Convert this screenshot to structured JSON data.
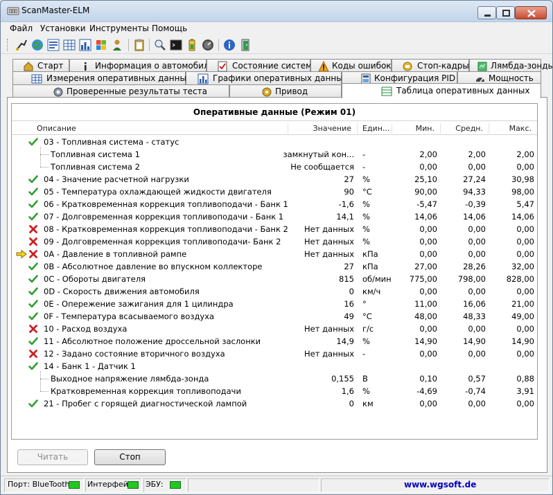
{
  "window": {
    "title": "ScanMaster-ELM"
  },
  "menu": [
    "Файл",
    "Установки",
    "Инструменты",
    "Помощь"
  ],
  "toolbar_icons": [
    "connect-icon",
    "globe-icon",
    "info-icon",
    "table-icon",
    "chart-icon",
    "windows-icon",
    "person-icon",
    "clipboard-icon",
    "search-icon",
    "terminal-icon",
    "battery-icon",
    "gauge-icon",
    "help-icon",
    "exit-icon"
  ],
  "tabs": {
    "row1": [
      {
        "label": "Старт",
        "icon": "home-icon"
      },
      {
        "label": "Информация о автомобиле",
        "icon": "info-icon"
      },
      {
        "label": "Состояние системы",
        "icon": "checklist-icon"
      },
      {
        "label": "Коды ошибок",
        "icon": "warning-icon"
      },
      {
        "label": "Стоп-кадры",
        "icon": "freeze-icon"
      },
      {
        "label": "Лямбда-зонды",
        "icon": "sensor-icon"
      }
    ],
    "row2": [
      {
        "label": "Измерения оперативных данных",
        "icon": "grid-icon"
      },
      {
        "label": "Графики оперативных данных",
        "icon": "chart-icon"
      },
      {
        "label": "Конфигурация PID",
        "icon": "config-icon"
      },
      {
        "label": "Мощность",
        "icon": "speedometer-icon"
      }
    ],
    "row3": [
      {
        "label": "Проверенные результаты теста",
        "icon": "gear-icon"
      },
      {
        "label": "Привод",
        "icon": "drive-icon"
      },
      {
        "label": "Таблица оперативных данных",
        "icon": "table-icon",
        "active": true
      }
    ]
  },
  "grid": {
    "title": "Оперативные данные (Режим 01)",
    "columns": {
      "desc": "Описание",
      "value": "Значение",
      "unit": "Един...",
      "min": "Мин.",
      "avg": "Средн.",
      "max": "Макс."
    },
    "rows": [
      {
        "mark": "check",
        "desc": "03 - Топливная система - статус",
        "value": "",
        "unit": "",
        "min": "",
        "avg": "",
        "max": ""
      },
      {
        "mark": "child",
        "desc": "Топливная система 1",
        "value": "замкнутый кон...",
        "unit": "-",
        "min": "2,00",
        "avg": "2,00",
        "max": "2,00"
      },
      {
        "mark": "child",
        "desc": "Топливная система 2",
        "value": "Не сообщается",
        "unit": "-",
        "min": "0,00",
        "avg": "0,00",
        "max": "0,00"
      },
      {
        "mark": "check",
        "desc": "04 - Значение расчетной нагрузки",
        "value": "27",
        "unit": "%",
        "min": "25,10",
        "avg": "27,24",
        "max": "30,98"
      },
      {
        "mark": "check",
        "desc": "05 - Температура охлаждающей жидкости двигателя",
        "value": "90",
        "unit": "°C",
        "min": "90,00",
        "avg": "94,33",
        "max": "98,00"
      },
      {
        "mark": "check",
        "desc": "06 - Кратковременная коррекция топливоподачи - Банк 1",
        "value": "-1,6",
        "unit": "%",
        "min": "-5,47",
        "avg": "-0,39",
        "max": "5,47"
      },
      {
        "mark": "check",
        "desc": "07 - Долговременная коррекция топливоподачи - Банк 1",
        "value": "14,1",
        "unit": "%",
        "min": "14,06",
        "avg": "14,06",
        "max": "14,06"
      },
      {
        "mark": "cross",
        "desc": "08 - Кратковременная коррекция топливоподачи - Банк 2",
        "value": "Нет данных",
        "unit": "%",
        "min": "0,00",
        "avg": "0,00",
        "max": "0,00"
      },
      {
        "mark": "cross",
        "desc": "09 - Долговременная коррекция топливоподачи- Банк 2",
        "value": "Нет данных",
        "unit": "%",
        "min": "0,00",
        "avg": "0,00",
        "max": "0,00"
      },
      {
        "mark": "cross",
        "indicator": true,
        "desc": "0A - Давление в топливной рампе",
        "value": "Нет данных",
        "unit": "кПа",
        "min": "0,00",
        "avg": "0,00",
        "max": "0,00"
      },
      {
        "mark": "check",
        "desc": "0B - Абсолютное давление во впускном коллекторе",
        "value": "27",
        "unit": "кПа",
        "min": "27,00",
        "avg": "28,26",
        "max": "32,00"
      },
      {
        "mark": "check",
        "desc": "0C - Обороты двигателя",
        "value": "815",
        "unit": "об/мин",
        "min": "775,00",
        "avg": "798,00",
        "max": "828,00"
      },
      {
        "mark": "check",
        "desc": "0D - Скорость движения автомобиля",
        "value": "0",
        "unit": "км/ч",
        "min": "0,00",
        "avg": "0,00",
        "max": "0,00"
      },
      {
        "mark": "check",
        "desc": "0E - Опережение зажигания для 1 цилиндра",
        "value": "16",
        "unit": "°",
        "min": "11,00",
        "avg": "16,06",
        "max": "21,00"
      },
      {
        "mark": "check",
        "desc": "0F - Температура всасываемого воздуха",
        "value": "49",
        "unit": "°C",
        "min": "48,00",
        "avg": "48,33",
        "max": "49,00"
      },
      {
        "mark": "cross",
        "desc": "10 - Расход воздуха",
        "value": "Нет данных",
        "unit": "г/с",
        "min": "0,00",
        "avg": "0,00",
        "max": "0,00"
      },
      {
        "mark": "check",
        "desc": "11 - Абсолютное положение дроссельной заслонки",
        "value": "14,9",
        "unit": "%",
        "min": "14,90",
        "avg": "14,90",
        "max": "14,90"
      },
      {
        "mark": "cross",
        "desc": "12 - Задано состояние вторичного воздуха",
        "value": "Нет данных",
        "unit": "-",
        "min": "0,00",
        "avg": "0,00",
        "max": "0,00"
      },
      {
        "mark": "check",
        "desc": "14 - Банк 1 - Датчик 1",
        "value": "",
        "unit": "",
        "min": "",
        "avg": "",
        "max": ""
      },
      {
        "mark": "child",
        "desc": "Выходное напряжение лямбда-зонда",
        "value": "0,155",
        "unit": "В",
        "min": "0,10",
        "avg": "0,57",
        "max": "0,88"
      },
      {
        "mark": "child",
        "desc": "Кратковременная коррекция топливоподачи",
        "value": "1,6",
        "unit": "%",
        "min": "-4,69",
        "avg": "-0,74",
        "max": "3,91"
      },
      {
        "mark": "check",
        "desc": "21 - Пробег с горящей диагностической лампой",
        "value": "0",
        "unit": "км",
        "min": "0,00",
        "avg": "0,00",
        "max": "0,00"
      }
    ]
  },
  "buttons": {
    "read": "Читать",
    "stop": "Стоп"
  },
  "status": {
    "port_label": "Порт: BlueTooth",
    "interface_label": "Интерфейс:",
    "ecu_label": "ЭБУ:",
    "link": "www.wgsoft.de",
    "led_color": "#22c722"
  }
}
